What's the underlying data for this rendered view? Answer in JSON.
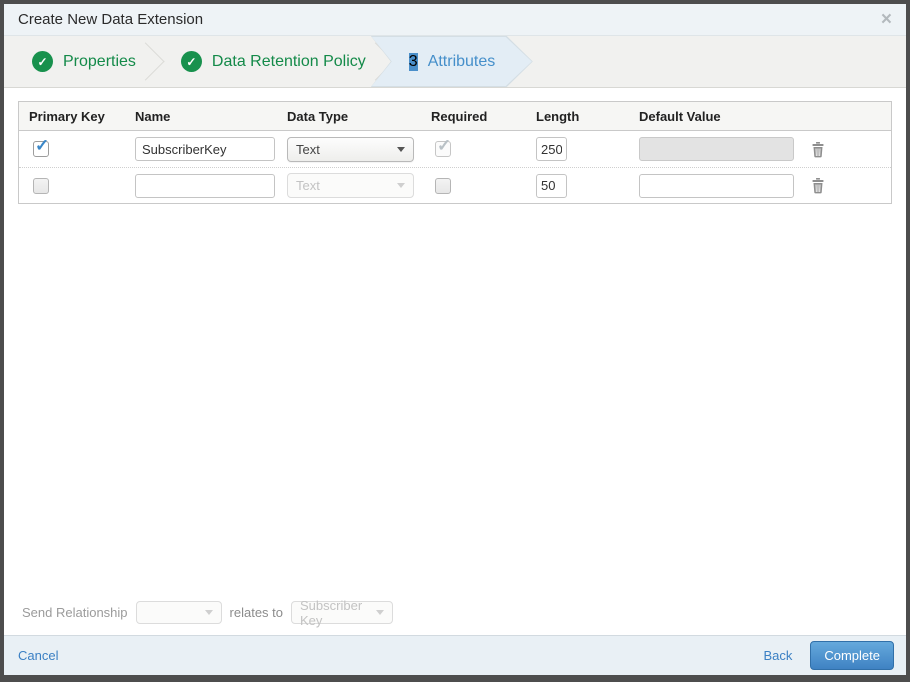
{
  "modal": {
    "title": "Create New Data Extension"
  },
  "icons": {
    "check": "✓",
    "close": "×"
  },
  "wizard": {
    "steps": [
      {
        "label": "Properties",
        "status": "complete"
      },
      {
        "label": "Data Retention Policy",
        "status": "complete"
      },
      {
        "label": "Attributes",
        "status": "active",
        "number": "3"
      }
    ]
  },
  "table": {
    "headers": {
      "primary_key": "Primary Key",
      "name": "Name",
      "data_type": "Data Type",
      "required": "Required",
      "length": "Length",
      "default_value": "Default Value"
    },
    "rows": [
      {
        "primary_key": true,
        "name": "SubscriberKey",
        "data_type": "Text",
        "required": true,
        "length": "250",
        "default_value": "",
        "default_disabled": true
      },
      {
        "primary_key": false,
        "name": "",
        "data_type": "Text",
        "required": false,
        "length": "50",
        "default_value": "",
        "default_disabled": false
      }
    ]
  },
  "send_relationship": {
    "label": "Send Relationship",
    "relates_to": "relates to",
    "target_field": "Subscriber Key"
  },
  "footer": {
    "cancel": "Cancel",
    "back": "Back",
    "complete": "Complete"
  },
  "colors": {
    "accent_blue": "#4a8fca",
    "success_green": "#18914d",
    "button_blue": "#3f82c3"
  }
}
